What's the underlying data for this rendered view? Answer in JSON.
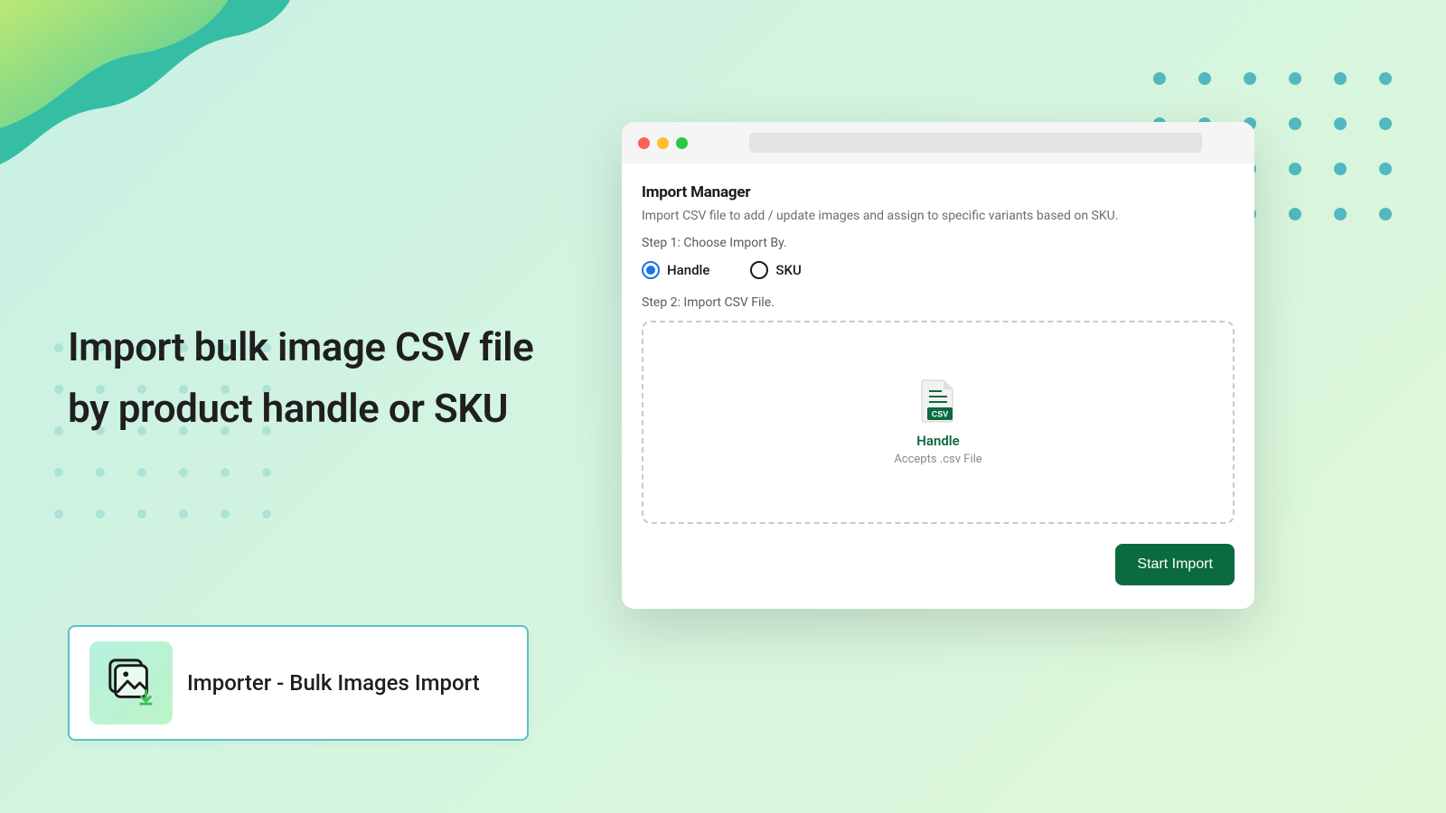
{
  "headline": "Import bulk image CSV file by product handle or SKU",
  "badge": {
    "name": "Importer - Bulk Images Import"
  },
  "window": {
    "title": "Import Manager",
    "subtitle": "Import CSV file to add / update images and assign to specific  variants based on SKU.",
    "step1_label": "Step 1: Choose Import By.",
    "step2_label": "Step 2: Import CSV File.",
    "radio_options": {
      "handle": "Handle",
      "sku": "SKU"
    },
    "dropzone": {
      "title": "Handle",
      "sub": "Accepts .csv File"
    },
    "primary_button": "Start Import"
  },
  "colors": {
    "primary_btn": "#0a6b3f",
    "accent_blue": "#1b73e8"
  }
}
